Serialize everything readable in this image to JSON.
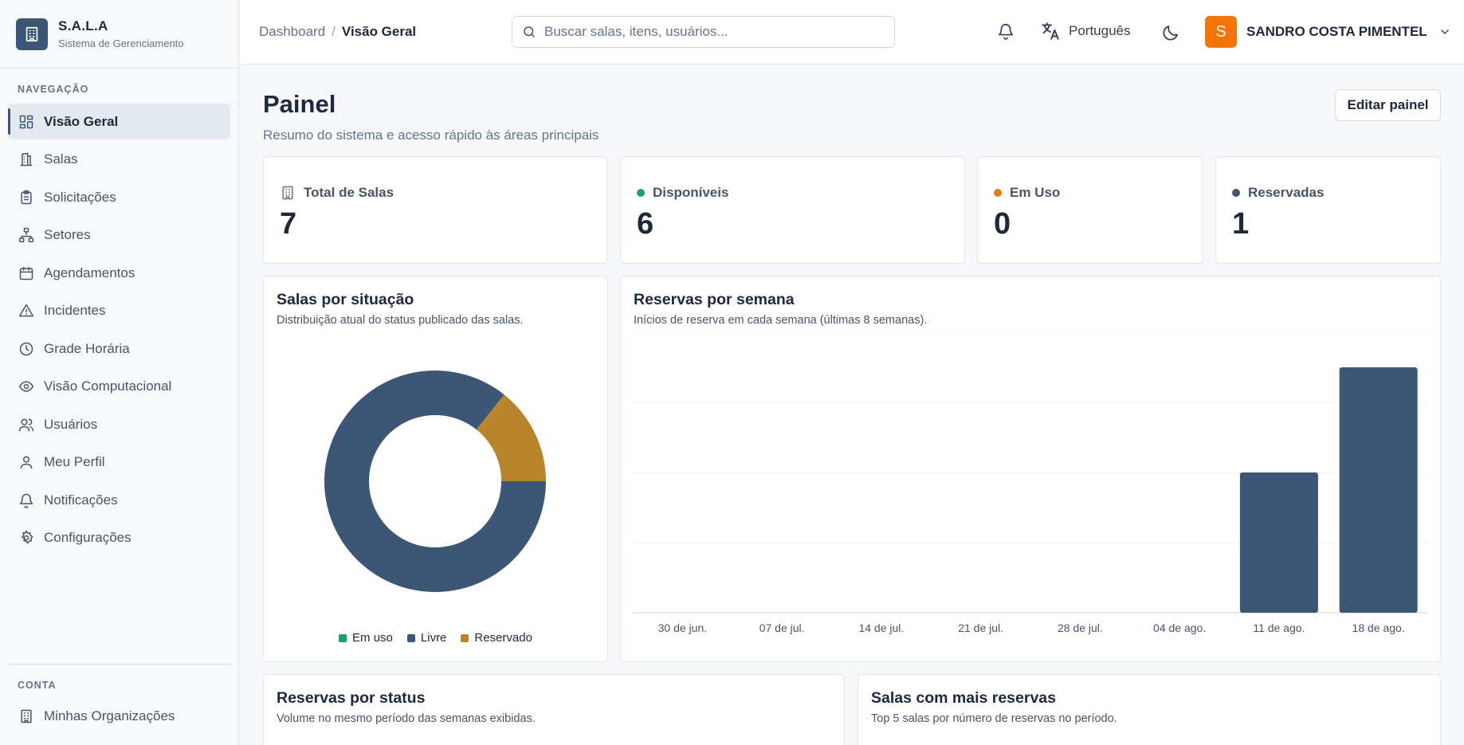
{
  "brand": {
    "title": "S.A.L.A",
    "subtitle": "Sistema de Gerenciamento"
  },
  "sidebar": {
    "section_label": "NAVEGAÇÃO",
    "items": [
      {
        "label": "Visão Geral",
        "icon": "grid-icon",
        "active": true
      },
      {
        "label": "Salas",
        "icon": "building-icon"
      },
      {
        "label": "Solicitações",
        "icon": "clipboard-icon"
      },
      {
        "label": "Setores",
        "icon": "network-icon"
      },
      {
        "label": "Agendamentos",
        "icon": "calendar-icon"
      },
      {
        "label": "Incidentes",
        "icon": "warning-icon"
      },
      {
        "label": "Grade Horária",
        "icon": "clock-icon"
      },
      {
        "label": "Visão Computacional",
        "icon": "eye-icon"
      },
      {
        "label": "Usuários",
        "icon": "users-icon"
      },
      {
        "label": "Meu Perfil",
        "icon": "user-icon"
      },
      {
        "label": "Notificações",
        "icon": "bell-icon"
      },
      {
        "label": "Configurações",
        "icon": "gear-icon"
      }
    ],
    "account_label": "CONTA",
    "account_item": {
      "label": "Minhas Organizações",
      "icon": "organization-icon"
    }
  },
  "header": {
    "breadcrumb_root": "Dashboard",
    "breadcrumb_sep": "/",
    "breadcrumb_current": "Visão Geral",
    "search_placeholder": "Buscar salas, itens, usuários...",
    "language": "Português",
    "user_initial": "S",
    "user_name": "SANDRO COSTA PIMENTEL"
  },
  "page": {
    "title": "Painel",
    "subtitle": "Resumo do sistema e acesso rápido às áreas principais",
    "edit_button": "Editar painel"
  },
  "stats": [
    {
      "label": "Total de Salas",
      "value": "7"
    },
    {
      "label": "Disponíveis",
      "value": "6",
      "color": "#1f9d6b"
    },
    {
      "label": "Em Uso",
      "value": "0",
      "color": "#ea7a12"
    },
    {
      "label": "Reservadas",
      "value": "1",
      "color": "#475569"
    }
  ],
  "donut_card": {
    "title": "Salas por situação",
    "subtitle": "Distribuição atual do status publicado das salas."
  },
  "bar_card": {
    "title": "Reservas por semana",
    "subtitle": "Inícios de reserva em cada semana (últimas 8 semanas)."
  },
  "status_card": {
    "title": "Reservas por status",
    "subtitle": "Volume no mesmo período das semanas exibidas."
  },
  "top_rooms_card": {
    "title": "Salas com mais reservas",
    "subtitle": "Top 5 salas por número de reservas no período."
  },
  "chart_data": [
    {
      "type": "pie",
      "categories": [
        "Em uso",
        "Livre",
        "Reservado"
      ],
      "values": [
        0,
        6,
        1
      ],
      "colors": [
        "#1f9d6b",
        "#3d5675",
        "#b8852c"
      ],
      "legend": "bottom"
    },
    {
      "type": "bar",
      "categories": [
        "30 de jun.",
        "07 de jul.",
        "14 de jul.",
        "21 de jul.",
        "28 de jul.",
        "04 de ago.",
        "11 de ago.",
        "18 de ago."
      ],
      "values": [
        0,
        0,
        0,
        0,
        0,
        0,
        2,
        3.5
      ],
      "ylim": [
        0,
        4
      ],
      "grid": true,
      "color": "#3d5675"
    }
  ]
}
